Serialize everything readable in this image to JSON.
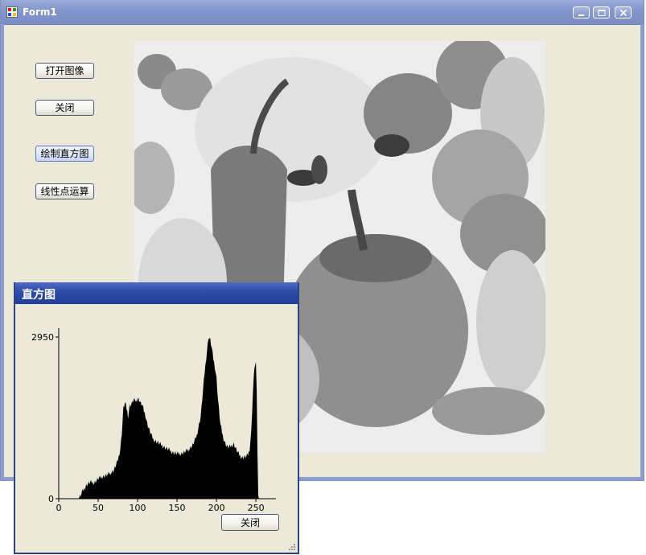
{
  "main_window": {
    "title": "Form1",
    "buttons": {
      "open_image": "打开图像",
      "close": "关闭",
      "draw_histogram": "绘制直方图",
      "linear_point_op": "线性点运算"
    },
    "image_description_icon": "peppers-negative-grayscale-photo"
  },
  "histogram_window": {
    "title": "直方图",
    "close_button": "关闭"
  },
  "chart_data": {
    "type": "area",
    "title": "",
    "xlabel": "",
    "ylabel": "",
    "xlim": [
      0,
      255
    ],
    "ylim": [
      0,
      2950
    ],
    "x_ticks": [
      0,
      50,
      100,
      150,
      200,
      250
    ],
    "y_ticks": [
      0,
      2950
    ],
    "fill_color": "#000000",
    "series": [
      {
        "x": [
          0,
          25,
          28,
          30,
          33,
          36,
          40,
          45,
          50,
          55,
          60,
          65,
          70,
          75,
          78,
          80,
          82,
          84,
          86,
          88,
          90,
          92,
          95,
          98,
          100,
          102,
          104,
          106,
          108,
          110,
          112,
          115,
          118,
          120,
          125,
          130,
          135,
          140,
          145,
          150,
          155,
          160,
          165,
          170,
          175,
          180,
          185,
          188,
          190,
          192,
          194,
          196,
          198,
          200,
          202,
          205,
          208,
          210,
          213,
          215,
          218,
          220,
          222,
          225,
          228,
          230,
          233,
          235,
          238,
          240,
          242,
          244,
          246,
          248,
          250,
          251,
          252,
          253,
          254,
          255
        ],
        "y": [
          0,
          0,
          60,
          130,
          200,
          260,
          300,
          290,
          360,
          400,
          420,
          460,
          520,
          700,
          900,
          1200,
          1650,
          1750,
          1650,
          1500,
          1700,
          1720,
          1800,
          1780,
          1830,
          1800,
          1740,
          1700,
          1600,
          1520,
          1380,
          1250,
          1140,
          1080,
          1030,
          980,
          930,
          890,
          840,
          820,
          820,
          850,
          900,
          980,
          1150,
          1500,
          2300,
          2700,
          2950,
          2900,
          2750,
          2550,
          2400,
          2200,
          1800,
          1350,
          1150,
          1050,
          960,
          940,
          950,
          980,
          1000,
          900,
          820,
          780,
          750,
          760,
          770,
          800,
          900,
          1200,
          1850,
          2400,
          2450,
          2000,
          800,
          100,
          0,
          0
        ]
      }
    ]
  }
}
